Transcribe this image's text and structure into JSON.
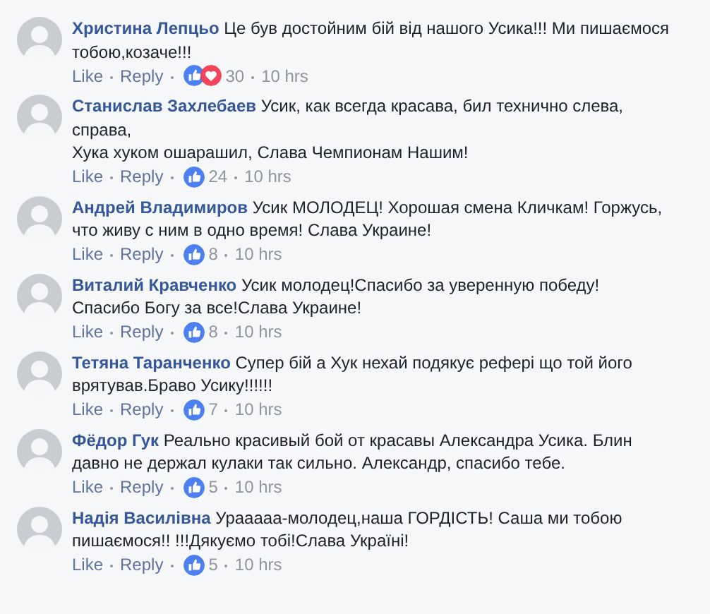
{
  "comments": [
    {
      "author": "Христина Лепцьо",
      "text": "Це був достойним бій від нашого Усика!!! Ми пишаємося тобою,козаче!!!",
      "actions": [
        "Like",
        "Reply"
      ],
      "reactions": [
        {
          "kind": "like"
        },
        {
          "kind": "love"
        }
      ],
      "count": "30",
      "time": "10 hrs"
    },
    {
      "author": "Станислав Захлебаев",
      "text": "Усик, как всегда красава, бил технично слева, справа,\nХука хуком ошарашил, Слава Чемпионам Нашим!",
      "actions": [
        "Like",
        "Reply"
      ],
      "reactions": [
        {
          "kind": "like"
        }
      ],
      "count": "24",
      "time": "10 hrs"
    },
    {
      "author": "Андрей Владимиров",
      "text": "Усик МОЛОДЕЦ! Хорошая смена Кличкам! Горжусь, что живу с ним в одно время! Слава Украине!",
      "actions": [
        "Like",
        "Reply"
      ],
      "reactions": [
        {
          "kind": "like"
        }
      ],
      "count": "8",
      "time": "10 hrs"
    },
    {
      "author": "Виталий Кравченко",
      "text": "Усик молодец!Спасибо за уверенную победу!\nСпасибо Богу за все!Слава Украине!",
      "actions": [
        "Like",
        "Reply"
      ],
      "reactions": [
        {
          "kind": "like"
        }
      ],
      "count": "8",
      "time": "10 hrs"
    },
    {
      "author": "Тетяна Таранченко",
      "text": "Супер бій а Хук нехай подякує рефері що той його врятував.Браво Усику!!!!!!",
      "actions": [
        "Like",
        "Reply"
      ],
      "reactions": [
        {
          "kind": "like"
        }
      ],
      "count": "7",
      "time": "10 hrs"
    },
    {
      "author": "Фёдор Гук",
      "text": "Реально красивый бой от красавы Александра Усика. Блин давно не держал кулаки так сильно. Александр, спасибо тебе.",
      "actions": [
        "Like",
        "Reply"
      ],
      "reactions": [
        {
          "kind": "like"
        }
      ],
      "count": "5",
      "time": "10 hrs"
    },
    {
      "author": "Надія Василівна",
      "text": "Урааааа-молодец,наша ГОРДІСТЬ! Саша ми тобою пишаємося!! !!!Дякуємо тобі!Слава Україні!",
      "actions": [
        "Like",
        "Reply"
      ],
      "reactions": [
        {
          "kind": "like"
        }
      ],
      "count": "5",
      "time": "10 hrs"
    }
  ]
}
